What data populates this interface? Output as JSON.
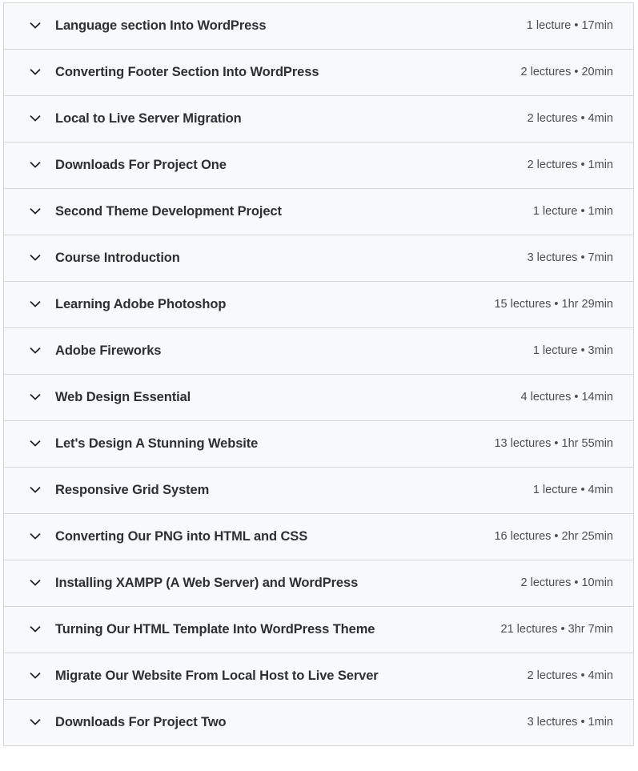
{
  "accordion": {
    "name": "course-curriculum-accordion",
    "colors": {
      "row_background": "#f7f9fa",
      "border": "#d1d7dc",
      "title_text": "#2d2f31",
      "meta_text": "#4b4f54",
      "page_background": "#ffffff"
    },
    "icon": {
      "expand_icon_name": "chevron-down-icon",
      "glyph": "chevron-down"
    },
    "meta_separator": "•",
    "sections": [
      {
        "title": "Language section Into WordPress",
        "lectures": "1 lecture",
        "duration": "17min",
        "meta": "1 lecture • 17min"
      },
      {
        "title": "Converting Footer Section Into WordPress",
        "lectures": "2 lectures",
        "duration": "20min",
        "meta": "2 lectures • 20min"
      },
      {
        "title": "Local to Live Server Migration",
        "lectures": "2 lectures",
        "duration": "4min",
        "meta": "2 lectures • 4min"
      },
      {
        "title": "Downloads For Project One",
        "lectures": "2 lectures",
        "duration": "1min",
        "meta": "2 lectures • 1min"
      },
      {
        "title": "Second Theme Development Project",
        "lectures": "1 lecture",
        "duration": "1min",
        "meta": "1 lecture • 1min"
      },
      {
        "title": "Course Introduction",
        "lectures": "3 lectures",
        "duration": "7min",
        "meta": "3 lectures • 7min"
      },
      {
        "title": "Learning Adobe Photoshop",
        "lectures": "15 lectures",
        "duration": "1hr 29min",
        "meta": "15 lectures • 1hr 29min"
      },
      {
        "title": "Adobe Fireworks",
        "lectures": "1 lecture",
        "duration": "3min",
        "meta": "1 lecture • 3min"
      },
      {
        "title": "Web Design Essential",
        "lectures": "4 lectures",
        "duration": "14min",
        "meta": "4 lectures • 14min"
      },
      {
        "title": "Let's Design A Stunning Website",
        "lectures": "13 lectures",
        "duration": "1hr 55min",
        "meta": "13 lectures • 1hr 55min"
      },
      {
        "title": "Responsive Grid System",
        "lectures": "1 lecture",
        "duration": "4min",
        "meta": "1 lecture • 4min"
      },
      {
        "title": "Converting Our PNG into HTML and CSS",
        "lectures": "16 lectures",
        "duration": "2hr 25min",
        "meta": "16 lectures • 2hr 25min"
      },
      {
        "title": "Installing XAMPP (A Web Server) and WordPress",
        "lectures": "2 lectures",
        "duration": "10min",
        "meta": "2 lectures • 10min"
      },
      {
        "title": "Turning Our HTML Template Into WordPress Theme",
        "lectures": "21 lectures",
        "duration": "3hr 7min",
        "meta": "21 lectures • 3hr 7min"
      },
      {
        "title": "Migrate Our Website From Local Host to Live Server",
        "lectures": "2 lectures",
        "duration": "4min",
        "meta": "2 lectures • 4min"
      },
      {
        "title": "Downloads For Project Two",
        "lectures": "3 lectures",
        "duration": "1min",
        "meta": "3 lectures • 1min"
      }
    ]
  }
}
